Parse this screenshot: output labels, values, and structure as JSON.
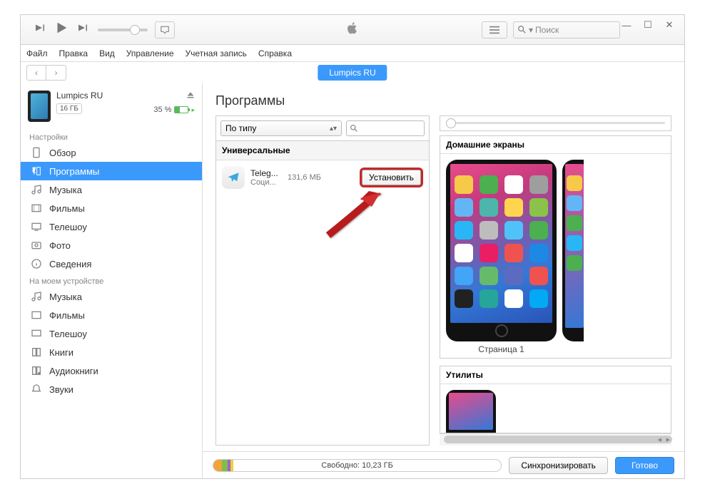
{
  "window": {
    "minimize": "—",
    "maximize": "☐",
    "close": "✕"
  },
  "search": {
    "placeholder": "Поиск"
  },
  "menubar": [
    "Файл",
    "Правка",
    "Вид",
    "Управление",
    "Учетная запись",
    "Справка"
  ],
  "device": {
    "name": "Lumpics RU",
    "capacity": "16 ГБ",
    "battery": "35 %"
  },
  "nav": {
    "pill": "Lumpics RU"
  },
  "sections": {
    "settings_label": "Настройки",
    "ondevice_label": "На моем устройстве",
    "settings": [
      "Обзор",
      "Программы",
      "Музыка",
      "Фильмы",
      "Телешоу",
      "Фото",
      "Сведения"
    ],
    "ondevice": [
      "Музыка",
      "Фильмы",
      "Телешоу",
      "Книги",
      "Аудиокниги",
      "Звуки"
    ]
  },
  "main": {
    "title": "Программы",
    "sort_by": "По типу",
    "category": "Универсальные",
    "app": {
      "name": "Teleg...",
      "subcat": "Соци...",
      "size": "131,6 МБ",
      "install": "Установить"
    },
    "screens_title": "Домашние экраны",
    "page_label": "Страница 1",
    "utilities_title": "Утилиты"
  },
  "footer": {
    "free": "Свободно: 10,23 ГБ",
    "sync": "Синхронизировать",
    "done": "Готово"
  },
  "icon_colors": [
    "#f7c948",
    "#4caf50",
    "#ffffff",
    "#9e9e9e",
    "#64b5f6",
    "#4db6ac",
    "#ffd54f",
    "#8bc34a",
    "#29b6f6",
    "#bdbdbd",
    "#4fc3f7",
    "#4caf50",
    "#ffffff",
    "#e91e63",
    "#ef5350",
    "#1e88e5",
    "#42a5f5",
    "#66bb6a",
    "#5c6bc0",
    "#ef5350",
    "#212121",
    "#26a69a",
    "#ffffff",
    "#03a9f4"
  ],
  "edge_icon_colors": [
    "#f7c948",
    "#64b5f6",
    "#4caf50",
    "#29b6f6",
    "#4caf50"
  ]
}
